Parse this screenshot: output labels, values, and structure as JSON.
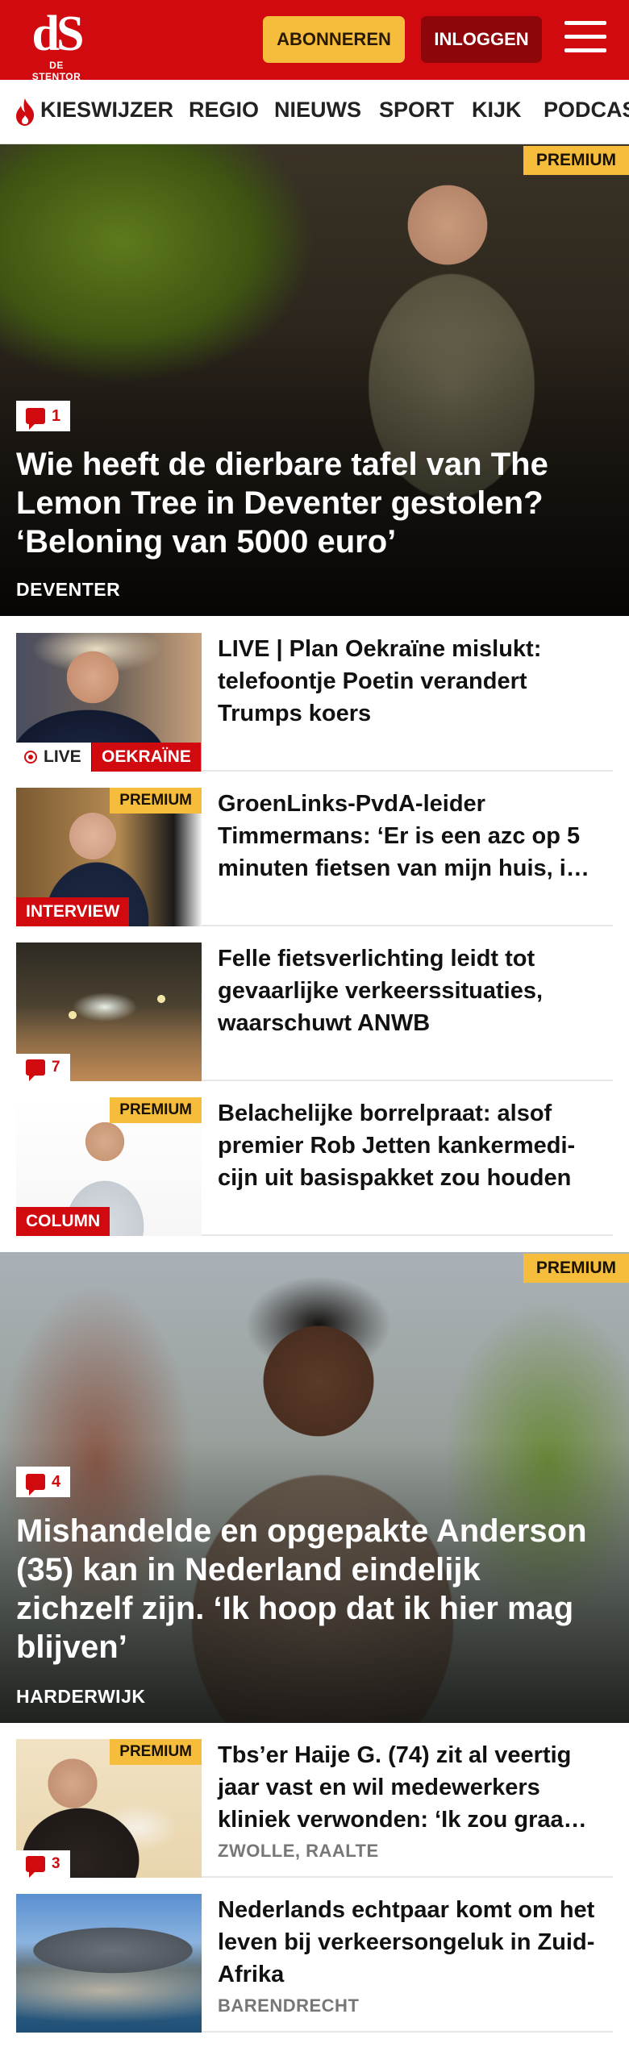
{
  "header": {
    "logo_text": "dS",
    "logo_sub": "DE STENTOR",
    "subscribe_label": "ABONNEREN",
    "login_label": "INLOGGEN",
    "brand_color": "#d10a10"
  },
  "nav": {
    "items": [
      "KIESWIJZER",
      "REGIO",
      "NIEUWS",
      "SPORT",
      "KIJK",
      "PODCAST"
    ]
  },
  "hero1": {
    "premium": "PREMIUM",
    "comments": "1",
    "title": "Wie heeft de dierbare tafel van The Lemon Tree in Deventer gestolen? ‘Beloning van 5000 euro’",
    "location": "DEVENTER"
  },
  "articles": [
    {
      "title": "LIVE | Plan Oekraïne mislukt: telefoontje Poetin verandert Trumps koers",
      "live_label": "LIVE",
      "tag": "OEKRAÏNE"
    },
    {
      "title": "GroenLinks-PvdA-leider Timmermans: ‘Er is een azc op 5 minuten fietsen van mijn huis, i…",
      "premium": "PREMIUM",
      "tag": "INTERVIEW"
    },
    {
      "title": "Felle fietsverlichting leidt tot gevaarlijke verkeerssituaties, waarschuwt ANWB",
      "comments": "7"
    },
    {
      "title": "Belachelijke borrelpraat: alsof premier Rob Jetten kankermedi-cijn uit basispakket zou houden",
      "premium": "PREMIUM",
      "tag": "COLUMN"
    }
  ],
  "hero2": {
    "premium": "PREMIUM",
    "comments": "4",
    "title": "Mishandelde en opgepakte Anderson (35) kan in Nederland eindelijk zichzelf zijn. ‘Ik hoop dat ik hier mag blijven’",
    "location": "HARDERWIJK"
  },
  "articles2": [
    {
      "title": "Tbs’er Haije G. (74) zit al veertig jaar vast en wil medewerkers kliniek verwonden: ‘Ik zou graa…",
      "premium": "PREMIUM",
      "comments": "3",
      "location": "ZWOLLE, RAALTE"
    },
    {
      "title": "Nederlands echtpaar komt om het leven bij verkeersongeluk in Zuid-Afrika",
      "location": "BARENDRECHT"
    }
  ]
}
